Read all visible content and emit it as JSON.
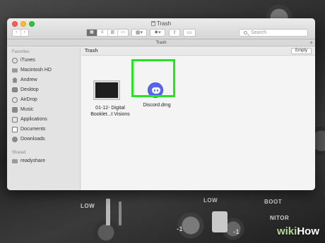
{
  "window": {
    "title": "Trash",
    "search_placeholder": "Search",
    "tab_title": "Trash",
    "tab_plus": "+"
  },
  "toolbar": {
    "back_glyph": "‹",
    "forward_glyph": "›",
    "view_modes": [
      "grid-view-icon",
      "list-view-icon",
      "column-view-icon",
      "gallery-view-icon"
    ],
    "share_glyph": "⇧"
  },
  "sidebar": {
    "favorites_heading": "Favorites",
    "favorites": [
      {
        "label": "iTunes",
        "icon": "music-note-icon"
      },
      {
        "label": "Macintosh HD",
        "icon": "hard-drive-icon"
      },
      {
        "label": "Andrew",
        "icon": "home-icon"
      },
      {
        "label": "Desktop",
        "icon": "desktop-icon"
      },
      {
        "label": "AirDrop",
        "icon": "airdrop-icon"
      },
      {
        "label": "Music",
        "icon": "music-folder-icon"
      },
      {
        "label": "Applications",
        "icon": "applications-icon"
      },
      {
        "label": "Documents",
        "icon": "documents-icon"
      },
      {
        "label": "Downloads",
        "icon": "downloads-icon"
      }
    ],
    "shared_heading": "Shared",
    "shared": [
      {
        "label": "readyshare",
        "icon": "network-drive-icon"
      }
    ]
  },
  "main": {
    "path_title": "Trash",
    "empty_button": "Empty",
    "files": [
      {
        "name_line1": "01-12- Digital",
        "name_line2": "Booklet...t Visions",
        "icon": "document-thumbnail-icon"
      },
      {
        "name_line1": "Discord.dmg",
        "icon": "discord-icon",
        "highlighted": true
      }
    ]
  },
  "colors": {
    "highlight": "#29e224",
    "discord": "#5865f2",
    "folder_blue": "#4a9be8"
  },
  "watermark": {
    "wiki": "wiki",
    "how": "How"
  },
  "background": {
    "labels": [
      "LOW",
      "LOW",
      "BOOT",
      "NITOR",
      "-1",
      "-1"
    ]
  }
}
